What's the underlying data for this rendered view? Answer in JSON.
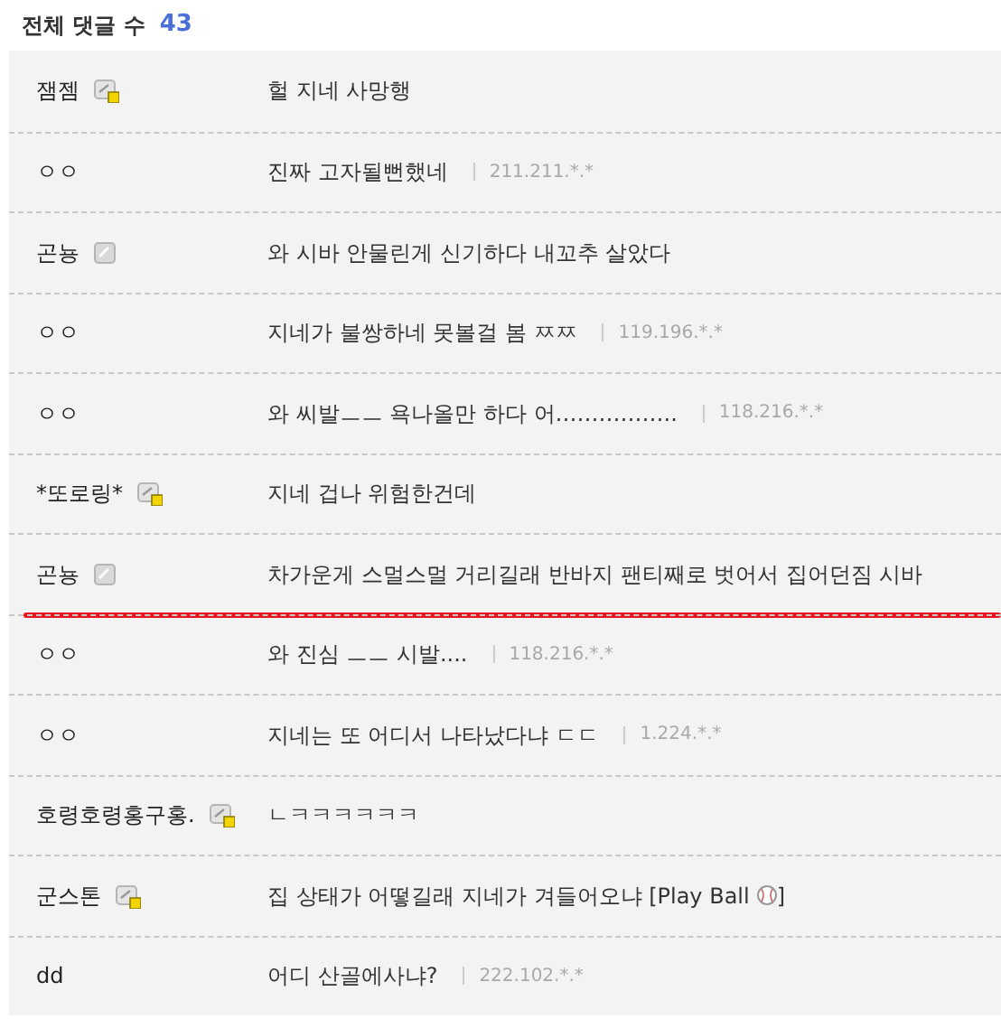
{
  "header": {
    "label": "전체 댓글 수",
    "count": "43"
  },
  "comments": [
    {
      "nick": "잼젬",
      "kind": "member",
      "text": "헐 지네 사망행"
    },
    {
      "nick": "ㅇㅇ",
      "kind": "guest",
      "text": "진짜 고자될뻔했네",
      "ip": "211.211.*.*"
    },
    {
      "nick": "곤뇽",
      "kind": "plain",
      "text": "와 시바 안물린게 신기하다 내꼬추 살았다"
    },
    {
      "nick": "ㅇㅇ",
      "kind": "guest",
      "text": "지네가 불쌍하네 못볼걸 봄 ㅉㅉ",
      "ip": "119.196.*.*"
    },
    {
      "nick": "ㅇㅇ",
      "kind": "guest",
      "text": "와 씨발ㅡㅡ 욕나올만 하다 어……………..",
      "ip": "118.216.*.*"
    },
    {
      "nick": "*또로링*",
      "kind": "member",
      "text": "지네 겁나 위험한건데"
    },
    {
      "nick": "곤뇽",
      "kind": "plain",
      "text": "차가운게 스멀스멀 거리길래 반바지 팬티째로 벗어서 집어던짐 시바",
      "underlined": true
    },
    {
      "nick": "ㅇㅇ",
      "kind": "guest",
      "text": "와 진심 ㅡㅡ 시발....",
      "ip": "118.216.*.*"
    },
    {
      "nick": "ㅇㅇ",
      "kind": "guest",
      "text": "지네는 또 어디서 나타났다냐 ㄷㄷ",
      "ip": "1.224.*.*"
    },
    {
      "nick": "호령호령홍구홍.",
      "kind": "member",
      "text": "ㄴㅋㅋㅋㅋㅋㅋ"
    },
    {
      "nick": "군스톤",
      "kind": "member",
      "text": "집 상태가 어떻길래 지네가 겨들어오냐 [Play Ball",
      "ball_icon": true,
      "text_end": "]"
    },
    {
      "nick": "dd",
      "kind": "guest",
      "text": "어디 산골에사냐?",
      "ip": "222.102.*.*"
    }
  ]
}
